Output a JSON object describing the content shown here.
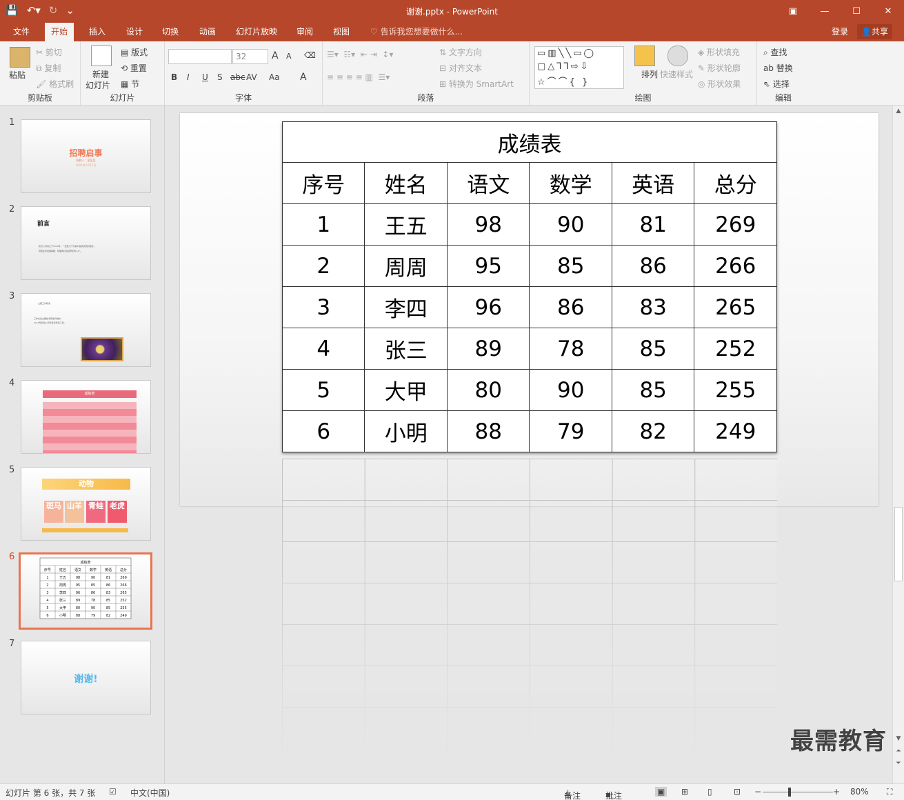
{
  "window": {
    "title": "谢谢.pptx - PowerPoint",
    "controls": [
      "▣",
      "—",
      "☐",
      "✕"
    ]
  },
  "tabs": [
    "文件",
    "开始",
    "插入",
    "设计",
    "切换",
    "动画",
    "幻灯片放映",
    "审阅",
    "视图"
  ],
  "active_tab": "开始",
  "tell_me": "告诉我您想要做什么...",
  "login": "登录",
  "share": "共享",
  "ribbon": {
    "clipboard": {
      "label": "剪贴板",
      "paste": "粘贴",
      "cut": "剪切",
      "copy": "复制",
      "format_painter": "格式刷"
    },
    "slides": {
      "label": "幻灯片",
      "new_slide": "新建",
      "new_slide2": "幻灯片",
      "layout": "版式",
      "reset": "重置",
      "section": "节"
    },
    "font": {
      "label": "字体",
      "font_size": "32",
      "grow": "A",
      "shrink": "A",
      "bold": "B",
      "italic": "I",
      "underline": "U",
      "shadow": "S",
      "strike": "abc",
      "spacing": "AV",
      "case": "Aa",
      "color": "A"
    },
    "paragraph": {
      "label": "段落",
      "text_direction": "文字方向",
      "align_text": "对齐文本",
      "smartart": "转换为 SmartArt"
    },
    "drawing": {
      "label": "绘图",
      "arrange": "排列",
      "quick_styles": "快速样式",
      "fill": "形状填充",
      "outline": "形状轮廓",
      "effects": "形状效果"
    },
    "editing": {
      "label": "编辑",
      "find": "查找",
      "replace": "替换",
      "select": "选择"
    }
  },
  "thumbnails": [
    {
      "num": "1",
      "title": "招聘启事",
      "line1": "招聘人：某某某",
      "line2": "2021年1月12日"
    },
    {
      "num": "2",
      "title": "前言",
      "line1": "我们公司成立于2010年，一直致力于为客户提供优质的服务。",
      "line2": "现因业务发展需要，特面向社会招聘优秀人才。"
    },
    {
      "num": "3",
      "title": "主要工作职责",
      "line1": "工作负责主要技术研发与维护。",
      "line2": "2018年获得公司年度优秀员工奖。"
    },
    {
      "num": "4",
      "title": "成绩表"
    },
    {
      "num": "5",
      "title": "动物",
      "tiles": [
        "斑马",
        "山羊",
        "青蛙",
        "老虎"
      ]
    },
    {
      "num": "6"
    },
    {
      "num": "7",
      "title": "谢谢!"
    }
  ],
  "table": {
    "title": "成绩表",
    "headers": [
      "序号",
      "姓名",
      "语文",
      "数学",
      "英语",
      "总分"
    ],
    "rows": [
      [
        "1",
        "王五",
        "98",
        "90",
        "81",
        "269"
      ],
      [
        "2",
        "周周",
        "95",
        "85",
        "86",
        "266"
      ],
      [
        "3",
        "李四",
        "96",
        "86",
        "83",
        "265"
      ],
      [
        "4",
        "张三",
        "89",
        "78",
        "85",
        "252"
      ],
      [
        "5",
        "大甲",
        "80",
        "90",
        "85",
        "255"
      ],
      [
        "6",
        "小明",
        "88",
        "79",
        "82",
        "249"
      ]
    ]
  },
  "watermark": "最需教育",
  "status": {
    "slide_info": "幻灯片 第 6 张，共 7 张",
    "language": "中文(中国)",
    "notes": "备注",
    "comments": "批注",
    "zoom": "80%"
  },
  "colors": {
    "accent": "#b7472a",
    "selected_thumb": "#e8744f",
    "thumb4_band": "#e96b7b"
  }
}
